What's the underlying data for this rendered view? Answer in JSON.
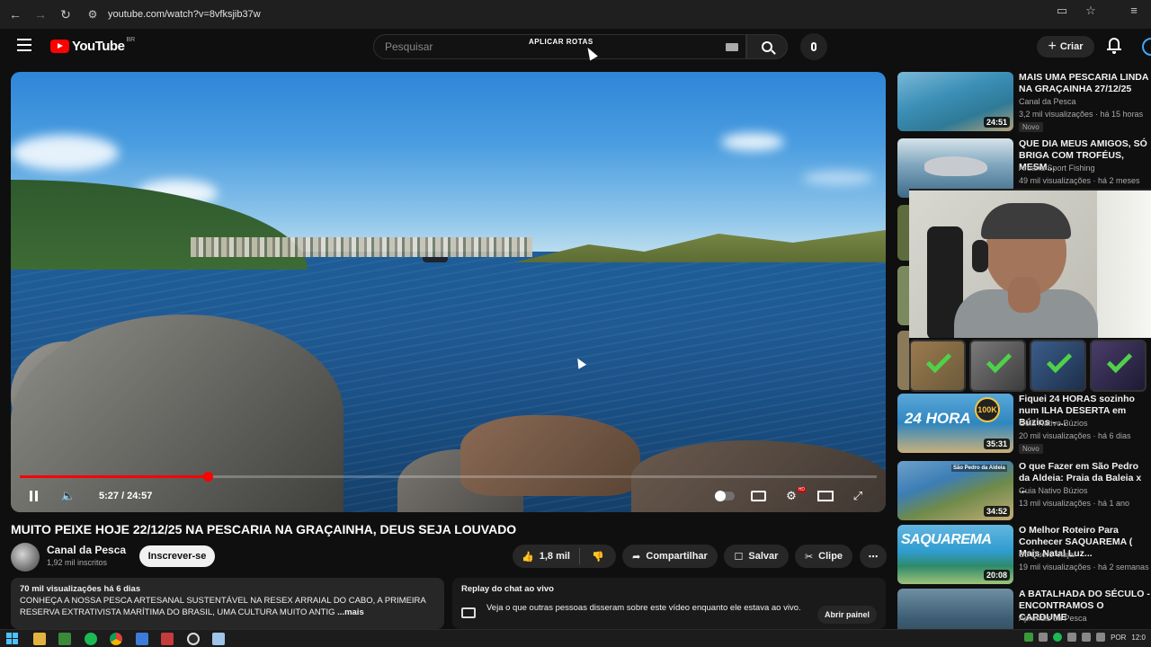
{
  "browser": {
    "url": "youtube.com/watch?v=8vfksjib37w"
  },
  "header": {
    "logo_text": "YouTube",
    "region": "BR",
    "search_placeholder": "Pesquisar",
    "overlay_text": "APLICAR ROTAS",
    "create_label": "Criar"
  },
  "player": {
    "current_time": "5:27",
    "duration": "24:57",
    "time_display": "5:27 / 24:57",
    "progress_fraction": 0.219
  },
  "video": {
    "title": "MUITO PEIXE HOJE 22/12/25 NA PESCARIA NA GRAÇAINHA, DEUS SEJA LOUVADO",
    "channel": "Canal da Pesca",
    "subscribers": "1,92 mil inscritos",
    "subscribe_label": "Inscrever-se",
    "likes": "1,8 mil",
    "share_label": "Compartilhar",
    "save_label": "Salvar",
    "clip_label": "Clipe"
  },
  "description": {
    "stats": "70 mil visualizações  há 6 dias",
    "text": "CONHEÇA A NOSSA PESCA ARTESANAL SUSTENTÁVEL NA RESEX ARRAIAL DO CABO, A PRIMEIRA RESERVA EXTRATIVISTA MARÍTIMA DO BRASIL, UMA CULTURA MUITO ANTIG",
    "more_label": "...mais"
  },
  "chat_replay": {
    "title": "Replay do chat ao vivo",
    "text": "Veja o que outras pessoas disseram sobre este vídeo enquanto ele estava ao vivo.",
    "button_label": "Abrir painel"
  },
  "recommendations": [
    {
      "title": "MAIS UMA PESCARIA LINDA NA GRAÇAINHA 27/12/25",
      "channel": "Canal da Pesca",
      "meta": "3,2 mil visualizações · há 15 horas",
      "badge": "Novo",
      "duration": "24:51"
    },
    {
      "title": "QUE DIA MEUS AMIGOS, SÓ BRIGA COM TROFÉUS, MESM...",
      "channel": "Aruana Sport Fishing",
      "meta": "49 mil visualizações · há 2 meses",
      "badge": "",
      "duration": ""
    },
    {
      "title": "Fiquei 24 HORAS sozinho num ILHA DESERTA em Búzios - ...",
      "channel": "Guia Nativo Búzios",
      "meta": "20 mil visualizações · há 6 dias",
      "badge": "Novo",
      "duration": "35:31",
      "thumb_text": "24 HORA",
      "thumb_badge": "100K"
    },
    {
      "title": "O que Fazer em São Pedro da Aldeia: Praia da Baleia x ...",
      "channel": "Guia Nativo Búzios",
      "meta": "13 mil visualizações · há 1 ano",
      "badge": "",
      "duration": "34:52",
      "thumb_text": "São Pedro da Aldeia"
    },
    {
      "title": "O Melhor Roteiro Para Conhecer SAQUAREMA ( Mais Natal Luz...",
      "channel": "Só Quero Viajar",
      "meta": "19 mil visualizações · há 2 semanas",
      "badge": "",
      "duration": "20:08",
      "thumb_text": "SAQUAREMA"
    },
    {
      "title": "A BATALHADA DO SÉCULO - ENCONTRAMOS O CARDUME",
      "channel": "Aprendiz da Pesca",
      "meta": "",
      "badge": "",
      "duration": ""
    }
  ],
  "taskbar": {
    "language": "POR",
    "clock": "12:0"
  },
  "colors": {
    "background": "#0f0f0f",
    "accent_red": "#ff0000",
    "surface": "#272727",
    "check_green": "#4fd14a"
  }
}
